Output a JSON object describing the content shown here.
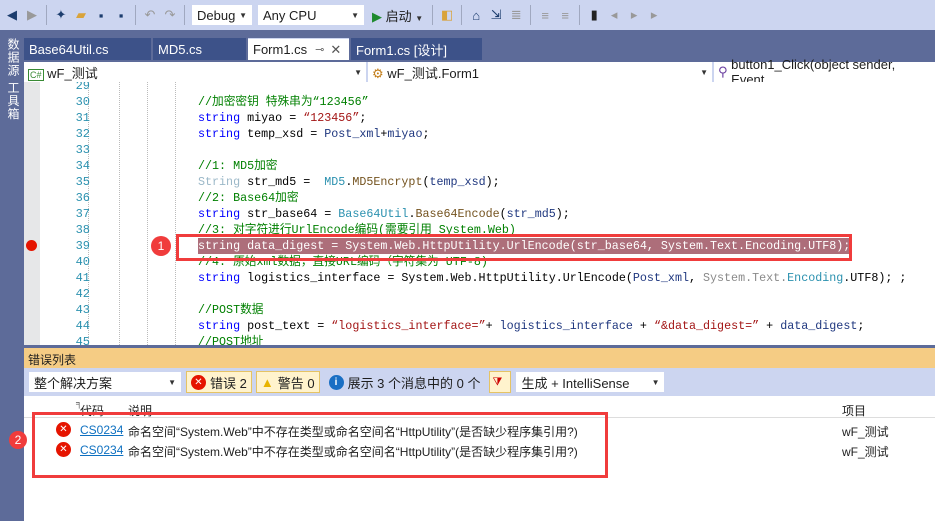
{
  "toolbar": {
    "config": "Debug",
    "platform": "Any CPU",
    "start": "启动"
  },
  "sidestrip": {
    "label": "数据源  工具箱"
  },
  "tabs": [
    {
      "label": "Base64Util.cs"
    },
    {
      "label": "MD5.cs"
    },
    {
      "label": "Form1.cs",
      "active": true
    },
    {
      "label": "Form1.cs [设计]"
    }
  ],
  "navbar": {
    "project": "wF_测试",
    "class": "wF_测试.Form1",
    "member": "button1_Click(object sender, Event"
  },
  "editor": {
    "lines": [
      {
        "n": "29",
        "t": []
      },
      {
        "n": "30",
        "t": [
          [
            "//加密密钥 特殊串为“123456”",
            "cm"
          ]
        ]
      },
      {
        "n": "31",
        "t": [
          [
            "string",
            "kw"
          ],
          [
            " miyao = ",
            "pl"
          ],
          [
            "“123456”",
            "st"
          ],
          [
            ";",
            "pl"
          ]
        ]
      },
      {
        "n": "32",
        "t": [
          [
            "string",
            "kw"
          ],
          [
            " temp_xsd = ",
            "pl"
          ],
          [
            "Post_xml",
            "id"
          ],
          [
            "+",
            "pl"
          ],
          [
            "miyao",
            "id"
          ],
          [
            ";",
            "pl"
          ]
        ]
      },
      {
        "n": "33",
        "t": []
      },
      {
        "n": "34",
        "t": [
          [
            "//1: MD5加密",
            "cm"
          ]
        ]
      },
      {
        "n": "35",
        "t": [
          [
            "String",
            "lt"
          ],
          [
            " str_md5 =  ",
            "pl"
          ],
          [
            "MD5",
            "ty"
          ],
          [
            ".",
            "pl"
          ],
          [
            "MD5Encrypt",
            "mt"
          ],
          [
            "(",
            "pl"
          ],
          [
            "temp_xsd",
            "id"
          ],
          [
            ");",
            "pl"
          ]
        ]
      },
      {
        "n": "36",
        "t": [
          [
            "//2: Base64加密",
            "cm"
          ]
        ]
      },
      {
        "n": "37",
        "t": [
          [
            "string",
            "kw"
          ],
          [
            " str_base64 = ",
            "pl"
          ],
          [
            "Base64Util",
            "ty"
          ],
          [
            ".",
            "pl"
          ],
          [
            "Base64Encode",
            "mt"
          ],
          [
            "(",
            "pl"
          ],
          [
            "str_md5",
            "id"
          ],
          [
            ");",
            "pl"
          ]
        ]
      },
      {
        "n": "38",
        "t": [
          [
            "//3: 对字符进行UrlEncode编码(需要引用 System.Web)",
            "cm"
          ]
        ]
      },
      {
        "n": "39",
        "hl": true,
        "bp": true,
        "t": [
          [
            "string data_digest = System.Web.HttpUtility.UrlEncode(str_base64, System.Text.Encoding.UTF8);",
            "pl"
          ]
        ]
      },
      {
        "n": "40",
        "t": [
          [
            "//4: 原始xml数据，直接URL编码（字符集为 UTF-8)",
            "cm"
          ]
        ]
      },
      {
        "n": "41",
        "t": [
          [
            "string",
            "kw"
          ],
          [
            " logistics_interface = System.Web.HttpUtility.UrlEncode(",
            "pl"
          ],
          [
            "Post_xml",
            "id"
          ],
          [
            ", ",
            "pl"
          ],
          [
            "System.Text.",
            "gy"
          ],
          [
            "Encoding",
            "ty"
          ],
          [
            ".UTF8); ;",
            "pl"
          ]
        ]
      },
      {
        "n": "42",
        "t": []
      },
      {
        "n": "43",
        "t": [
          [
            "//POST数据",
            "cm"
          ]
        ]
      },
      {
        "n": "44",
        "t": [
          [
            "string",
            "kw"
          ],
          [
            " post_text = ",
            "pl"
          ],
          [
            "“logistics_interface=”",
            "st"
          ],
          [
            "+ ",
            "pl"
          ],
          [
            "logistics_interface",
            "id"
          ],
          [
            " + ",
            "pl"
          ],
          [
            "“&data_digest=”",
            "st"
          ],
          [
            " + ",
            "pl"
          ],
          [
            "data_digest",
            "id"
          ],
          [
            ";",
            "pl"
          ]
        ]
      },
      {
        "n": "45",
        "t": [
          [
            "//POST地址",
            "cm"
          ]
        ]
      }
    ]
  },
  "errorlist": {
    "title": "错误列表",
    "scope": "整个解决方案",
    "errors_btn": "错误 2",
    "warnings_btn": "警告 0",
    "messages_btn": "展示 3 个消息中的 0 个",
    "build_filter": "生成 + IntelliSense",
    "headers": {
      "code": "代码",
      "desc": "说明",
      "project": "项目"
    },
    "rows": [
      {
        "code": "CS0234",
        "desc": "命名空间“System.Web”中不存在类型或命名空间名“HttpUtility”(是否缺少程序集引用?)",
        "project": "wF_测试"
      },
      {
        "code": "CS0234",
        "desc": "命名空间“System.Web”中不存在类型或命名空间名“HttpUtility”(是否缺少程序集引用?)",
        "project": "wF_测试"
      }
    ]
  },
  "annotations": [
    "1",
    "2"
  ],
  "colors": {
    "accent_error": "#e51400",
    "annotation": "#f03c3c",
    "panel_title": "#f5cc84"
  }
}
